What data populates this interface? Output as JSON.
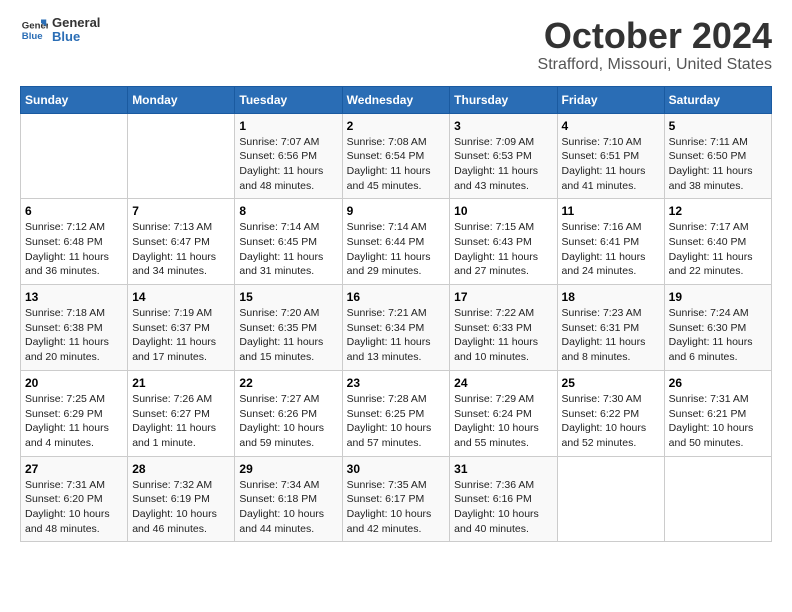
{
  "logo": {
    "line1": "General",
    "line2": "Blue"
  },
  "title": "October 2024",
  "location": "Strafford, Missouri, United States",
  "days_of_week": [
    "Sunday",
    "Monday",
    "Tuesday",
    "Wednesday",
    "Thursday",
    "Friday",
    "Saturday"
  ],
  "weeks": [
    [
      {
        "day": "",
        "sunrise": "",
        "sunset": "",
        "daylight": ""
      },
      {
        "day": "",
        "sunrise": "",
        "sunset": "",
        "daylight": ""
      },
      {
        "day": "1",
        "sunrise": "Sunrise: 7:07 AM",
        "sunset": "Sunset: 6:56 PM",
        "daylight": "Daylight: 11 hours and 48 minutes."
      },
      {
        "day": "2",
        "sunrise": "Sunrise: 7:08 AM",
        "sunset": "Sunset: 6:54 PM",
        "daylight": "Daylight: 11 hours and 45 minutes."
      },
      {
        "day": "3",
        "sunrise": "Sunrise: 7:09 AM",
        "sunset": "Sunset: 6:53 PM",
        "daylight": "Daylight: 11 hours and 43 minutes."
      },
      {
        "day": "4",
        "sunrise": "Sunrise: 7:10 AM",
        "sunset": "Sunset: 6:51 PM",
        "daylight": "Daylight: 11 hours and 41 minutes."
      },
      {
        "day": "5",
        "sunrise": "Sunrise: 7:11 AM",
        "sunset": "Sunset: 6:50 PM",
        "daylight": "Daylight: 11 hours and 38 minutes."
      }
    ],
    [
      {
        "day": "6",
        "sunrise": "Sunrise: 7:12 AM",
        "sunset": "Sunset: 6:48 PM",
        "daylight": "Daylight: 11 hours and 36 minutes."
      },
      {
        "day": "7",
        "sunrise": "Sunrise: 7:13 AM",
        "sunset": "Sunset: 6:47 PM",
        "daylight": "Daylight: 11 hours and 34 minutes."
      },
      {
        "day": "8",
        "sunrise": "Sunrise: 7:14 AM",
        "sunset": "Sunset: 6:45 PM",
        "daylight": "Daylight: 11 hours and 31 minutes."
      },
      {
        "day": "9",
        "sunrise": "Sunrise: 7:14 AM",
        "sunset": "Sunset: 6:44 PM",
        "daylight": "Daylight: 11 hours and 29 minutes."
      },
      {
        "day": "10",
        "sunrise": "Sunrise: 7:15 AM",
        "sunset": "Sunset: 6:43 PM",
        "daylight": "Daylight: 11 hours and 27 minutes."
      },
      {
        "day": "11",
        "sunrise": "Sunrise: 7:16 AM",
        "sunset": "Sunset: 6:41 PM",
        "daylight": "Daylight: 11 hours and 24 minutes."
      },
      {
        "day": "12",
        "sunrise": "Sunrise: 7:17 AM",
        "sunset": "Sunset: 6:40 PM",
        "daylight": "Daylight: 11 hours and 22 minutes."
      }
    ],
    [
      {
        "day": "13",
        "sunrise": "Sunrise: 7:18 AM",
        "sunset": "Sunset: 6:38 PM",
        "daylight": "Daylight: 11 hours and 20 minutes."
      },
      {
        "day": "14",
        "sunrise": "Sunrise: 7:19 AM",
        "sunset": "Sunset: 6:37 PM",
        "daylight": "Daylight: 11 hours and 17 minutes."
      },
      {
        "day": "15",
        "sunrise": "Sunrise: 7:20 AM",
        "sunset": "Sunset: 6:35 PM",
        "daylight": "Daylight: 11 hours and 15 minutes."
      },
      {
        "day": "16",
        "sunrise": "Sunrise: 7:21 AM",
        "sunset": "Sunset: 6:34 PM",
        "daylight": "Daylight: 11 hours and 13 minutes."
      },
      {
        "day": "17",
        "sunrise": "Sunrise: 7:22 AM",
        "sunset": "Sunset: 6:33 PM",
        "daylight": "Daylight: 11 hours and 10 minutes."
      },
      {
        "day": "18",
        "sunrise": "Sunrise: 7:23 AM",
        "sunset": "Sunset: 6:31 PM",
        "daylight": "Daylight: 11 hours and 8 minutes."
      },
      {
        "day": "19",
        "sunrise": "Sunrise: 7:24 AM",
        "sunset": "Sunset: 6:30 PM",
        "daylight": "Daylight: 11 hours and 6 minutes."
      }
    ],
    [
      {
        "day": "20",
        "sunrise": "Sunrise: 7:25 AM",
        "sunset": "Sunset: 6:29 PM",
        "daylight": "Daylight: 11 hours and 4 minutes."
      },
      {
        "day": "21",
        "sunrise": "Sunrise: 7:26 AM",
        "sunset": "Sunset: 6:27 PM",
        "daylight": "Daylight: 11 hours and 1 minute."
      },
      {
        "day": "22",
        "sunrise": "Sunrise: 7:27 AM",
        "sunset": "Sunset: 6:26 PM",
        "daylight": "Daylight: 10 hours and 59 minutes."
      },
      {
        "day": "23",
        "sunrise": "Sunrise: 7:28 AM",
        "sunset": "Sunset: 6:25 PM",
        "daylight": "Daylight: 10 hours and 57 minutes."
      },
      {
        "day": "24",
        "sunrise": "Sunrise: 7:29 AM",
        "sunset": "Sunset: 6:24 PM",
        "daylight": "Daylight: 10 hours and 55 minutes."
      },
      {
        "day": "25",
        "sunrise": "Sunrise: 7:30 AM",
        "sunset": "Sunset: 6:22 PM",
        "daylight": "Daylight: 10 hours and 52 minutes."
      },
      {
        "day": "26",
        "sunrise": "Sunrise: 7:31 AM",
        "sunset": "Sunset: 6:21 PM",
        "daylight": "Daylight: 10 hours and 50 minutes."
      }
    ],
    [
      {
        "day": "27",
        "sunrise": "Sunrise: 7:31 AM",
        "sunset": "Sunset: 6:20 PM",
        "daylight": "Daylight: 10 hours and 48 minutes."
      },
      {
        "day": "28",
        "sunrise": "Sunrise: 7:32 AM",
        "sunset": "Sunset: 6:19 PM",
        "daylight": "Daylight: 10 hours and 46 minutes."
      },
      {
        "day": "29",
        "sunrise": "Sunrise: 7:34 AM",
        "sunset": "Sunset: 6:18 PM",
        "daylight": "Daylight: 10 hours and 44 minutes."
      },
      {
        "day": "30",
        "sunrise": "Sunrise: 7:35 AM",
        "sunset": "Sunset: 6:17 PM",
        "daylight": "Daylight: 10 hours and 42 minutes."
      },
      {
        "day": "31",
        "sunrise": "Sunrise: 7:36 AM",
        "sunset": "Sunset: 6:16 PM",
        "daylight": "Daylight: 10 hours and 40 minutes."
      },
      {
        "day": "",
        "sunrise": "",
        "sunset": "",
        "daylight": ""
      },
      {
        "day": "",
        "sunrise": "",
        "sunset": "",
        "daylight": ""
      }
    ]
  ]
}
